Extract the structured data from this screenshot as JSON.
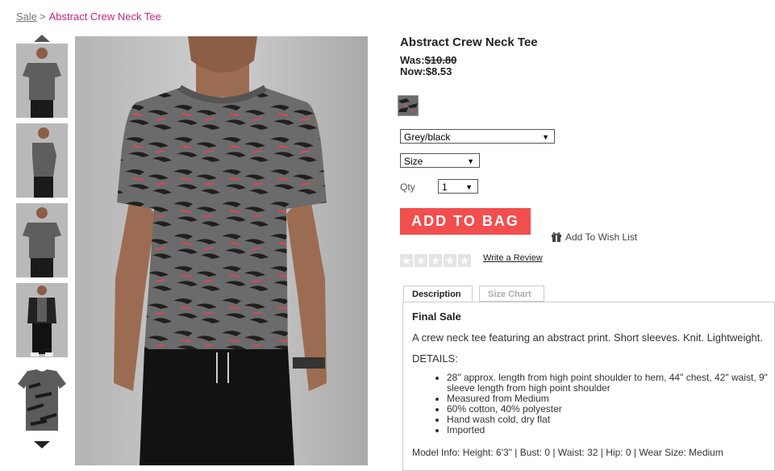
{
  "breadcrumb": {
    "parent": "Sale",
    "separator": ">",
    "current": "Abstract Crew Neck Tee"
  },
  "thumbnails": {
    "count": 5
  },
  "product": {
    "title": "Abstract Crew Neck Tee",
    "was_label": "Was:",
    "was_price": "$10.80",
    "now_label": "Now:",
    "now_price": "$8.53"
  },
  "options": {
    "color_value": "Grey/black",
    "size_value": "Size",
    "qty_label": "Qty",
    "qty_value": "1"
  },
  "actions": {
    "add_to_bag": "ADD TO BAG",
    "wish_list": "Add To Wish List",
    "write_review": "Write a Review"
  },
  "rating": {
    "stars_filled": 0,
    "stars_total": 5
  },
  "tabs": [
    {
      "label": "Description",
      "active": true
    },
    {
      "label": "Size Chart",
      "active": false
    }
  ],
  "description": {
    "heading": "Final Sale",
    "text": "A crew neck tee featuring an abstract print. Short sleeves. Knit. Lightweight.",
    "details_heading": "DETAILS:",
    "details": [
      "28\" approx. length from high point shoulder to hem, 44\" chest, 42\" waist, 9\" sleeve length from high point shoulder",
      "Measured from Medium",
      "60% cotton, 40% polyester",
      "Hand wash cold, dry flat",
      "Imported"
    ],
    "model_info": "Model Info: Height: 6'3\" | Bust: 0 | Waist: 32 | Hip: 0 | Wear Size: Medium"
  },
  "colors": {
    "accent": "#f24e4e",
    "breadcrumb_current": "#c0267f",
    "shirt": "#6b6b6b"
  }
}
